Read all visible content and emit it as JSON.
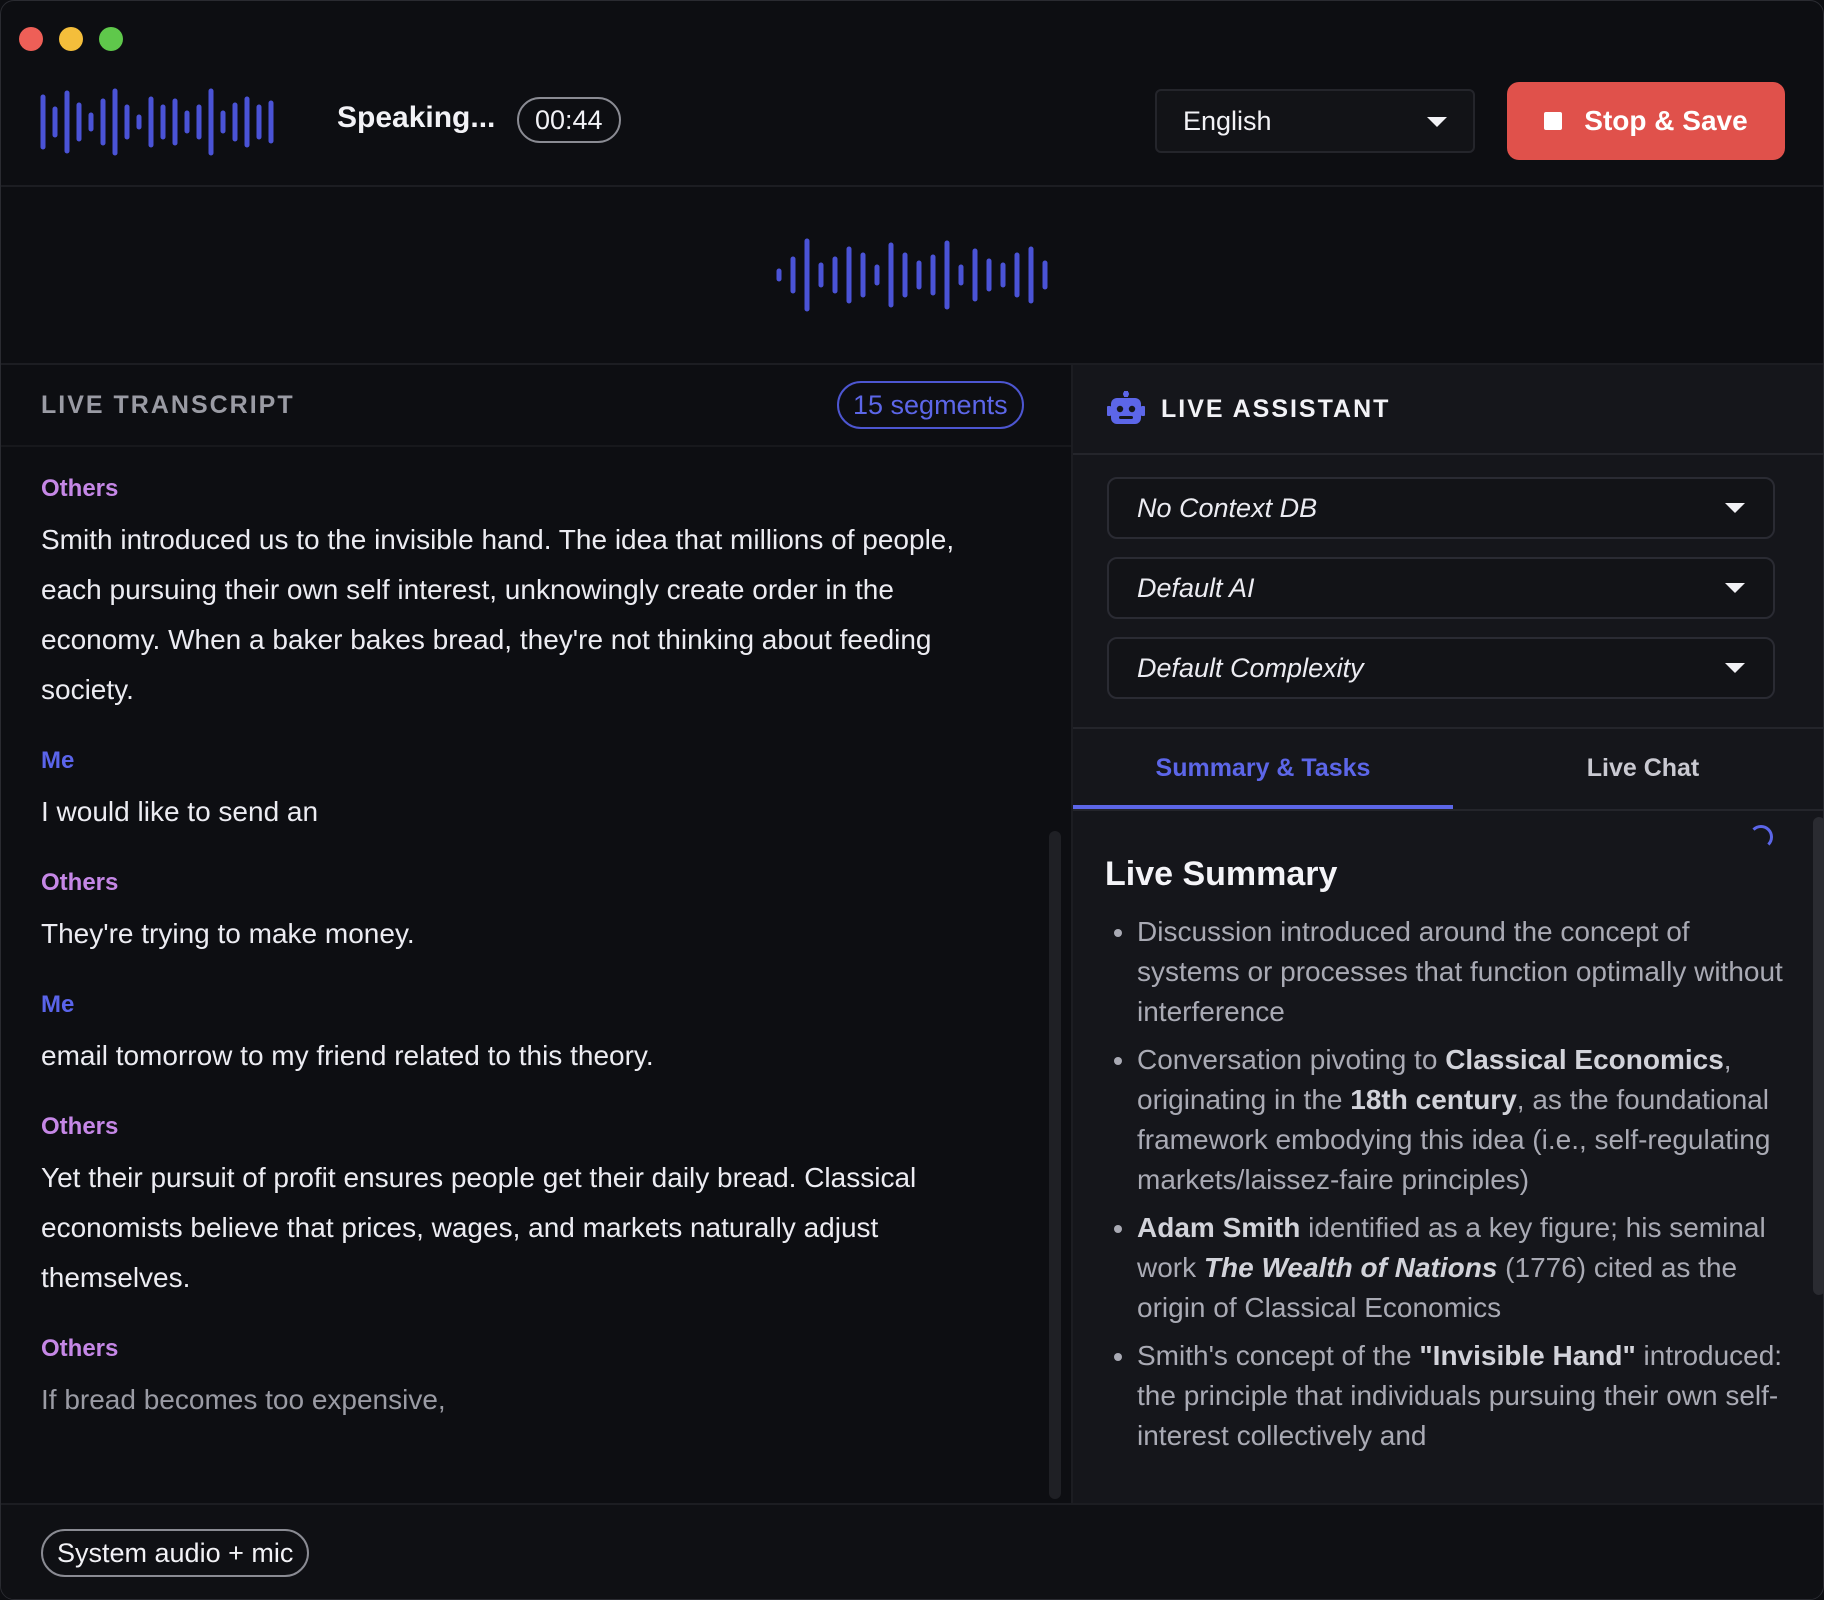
{
  "window": {
    "controls": [
      "close",
      "minimize",
      "maximize"
    ]
  },
  "topbar": {
    "status": "Speaking...",
    "timer": "00:44",
    "language": "English",
    "stop_label": "Stop & Save",
    "accent_color": "#5a64ea",
    "stop_color": "#e0514b"
  },
  "transcript": {
    "title": "LIVE TRANSCRIPT",
    "segment_count": "15 segments",
    "segments": [
      {
        "speaker": "Others",
        "text": "Smith introduced us to the invisible hand. The idea that millions of people, each pursuing their own self interest, unknowingly create order in the economy. When a baker bakes bread, they're not thinking about feeding society."
      },
      {
        "speaker": "Me",
        "text": "I would like to send an"
      },
      {
        "speaker": "Others",
        "text": "They're trying to make money."
      },
      {
        "speaker": "Me",
        "text": "email tomorrow to my friend related to this theory."
      },
      {
        "speaker": "Others",
        "text": "Yet their pursuit of profit ensures people get their daily bread. Classical economists believe that prices, wages, and markets naturally adjust themselves."
      },
      {
        "speaker": "Others",
        "text": "If bread becomes too expensive,"
      }
    ]
  },
  "assistant": {
    "title": "LIVE ASSISTANT",
    "icon": "robot-icon",
    "context_db": "No Context DB",
    "ai_model": "Default AI",
    "complexity": "Default Complexity",
    "tabs": [
      "Summary & Tasks",
      "Live Chat"
    ],
    "summary_title": "Live Summary",
    "summary_items": {
      "item1": "Discussion introduced around the concept of systems or processes that function optimally without interference",
      "item2": {
        "pre": "Conversation pivoting to ",
        "bold1": "Classical Economics",
        "mid": ", originating in the ",
        "bold2": "18th century",
        "post": ", as the foundational framework embodying this idea (i.e., self-regulating markets/laissez-faire principles)"
      },
      "item3": {
        "bold1": "Adam Smith",
        "mid": " identified as a key figure; his seminal work ",
        "bold_italic": "The Wealth of Nations",
        "post": " (1776) cited as the origin of Classical Economics"
      },
      "item4": {
        "pre": "Smith's concept of the ",
        "bold1": "\"Invisible Hand\"",
        "post": " introduced: the principle that individuals pursuing their own self-interest collectively and"
      }
    }
  },
  "bottombar": {
    "audio_source": "System audio + mic"
  }
}
